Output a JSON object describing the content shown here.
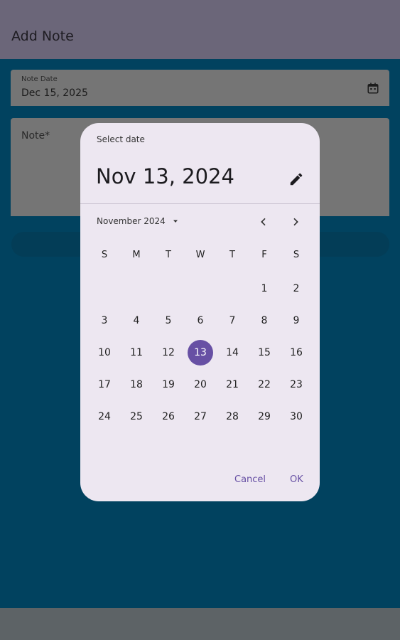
{
  "appbar": {
    "title": "Add Note"
  },
  "form": {
    "date_label": "Note Date",
    "date_value": "Dec 15, 2025",
    "note_label": "Note*"
  },
  "dialog": {
    "title": "Select date",
    "headline": "Nov 13, 2024",
    "month_year": "November 2024",
    "weekdays": [
      "S",
      "M",
      "T",
      "W",
      "T",
      "F",
      "S"
    ],
    "days": [
      "1",
      "2",
      "3",
      "4",
      "5",
      "6",
      "7",
      "8",
      "9",
      "10",
      "11",
      "12",
      "13",
      "14",
      "15",
      "16",
      "17",
      "18",
      "19",
      "20",
      "21",
      "22",
      "23",
      "24",
      "25",
      "26",
      "27",
      "28",
      "29",
      "30"
    ],
    "selected_day": "13",
    "cancel_label": "Cancel",
    "ok_label": "OK"
  },
  "colors": {
    "accent": "#6750a4",
    "scrim": "#01425f",
    "dialog_bg": "#ede7f1"
  },
  "icons": {
    "date_field": "calendar-icon",
    "edit": "pencil-icon",
    "month_dropdown": "caret-down-icon",
    "prev": "chevron-left-icon",
    "next": "chevron-right-icon"
  }
}
